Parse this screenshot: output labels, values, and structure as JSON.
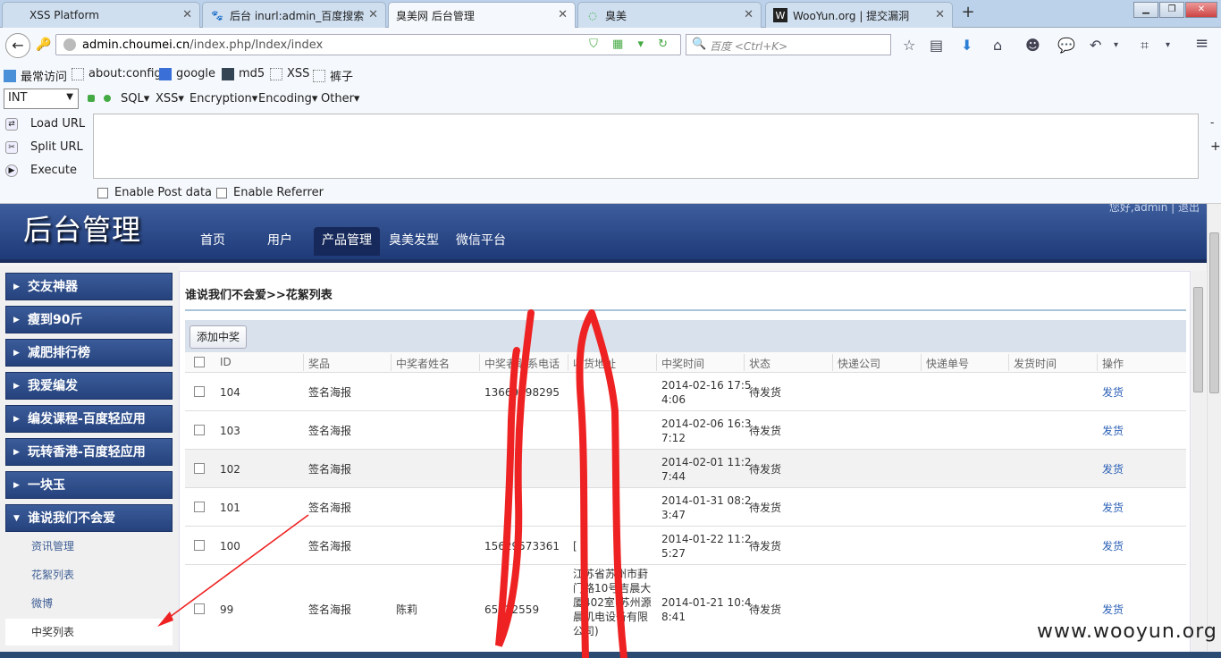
{
  "browser": {
    "tabs": [
      {
        "title": "XSS Platform"
      },
      {
        "title": "后台 inurl:admin_百度搜索"
      },
      {
        "title": "臭美网 后台管理"
      },
      {
        "title": "臭美"
      },
      {
        "title": "WooYun.org | 提交漏洞"
      }
    ],
    "active_tab": 2,
    "new_tab": "+",
    "url_host": "admin.choumei.cn",
    "url_path": "/index.php/Index/index",
    "search_placeholder": "百度 <Ctrl+K>"
  },
  "bookmarks": [
    "最常访问",
    "about:config",
    "google",
    "md5",
    "XSS",
    "裤子"
  ],
  "hackbar": {
    "select_value": "INT",
    "menus": [
      "SQL",
      "XSS",
      "Encryption",
      "Encoding",
      "Other"
    ],
    "load_url": "Load URL",
    "split_url": "Split URL",
    "execute": "Execute",
    "enable_post": "Enable Post data",
    "enable_referrer": "Enable Referrer",
    "side_minus": "-",
    "side_plus": "+"
  },
  "page": {
    "title": "后台管理",
    "user_line": "您好,admin | 退出",
    "nav": [
      "首页",
      "用户",
      "产品管理",
      "臭美发型",
      "微信平台"
    ],
    "active_nav": 2
  },
  "sidebar": {
    "groups": [
      "交友神器",
      "瘦到90斤",
      "减肥排行榜",
      "我爱编发",
      "编发课程-百度轻应用",
      "玩转香港-百度轻应用",
      "一块玉",
      "谁说我们不会爱"
    ],
    "sub_items": [
      "资讯管理",
      "花絮列表",
      "微博",
      "中奖列表"
    ],
    "active_sub": 3
  },
  "content": {
    "breadcrumb": "谁说我们不会爱>>花絮列表",
    "add_button": "添加中奖",
    "columns": [
      "ID",
      "奖品",
      "中奖者姓名",
      "中奖者联系电话",
      "收货地址",
      "中奖时间",
      "状态",
      "快递公司",
      "快递单号",
      "发货时间",
      "操作"
    ],
    "rows": [
      {
        "id": "104",
        "prize": "签名海报",
        "name": "",
        "phone": "13669798295",
        "address": "",
        "time1": "2014-02-16 17:5",
        "time2": "4:06",
        "status": "待发货",
        "action": "发货"
      },
      {
        "id": "103",
        "prize": "签名海报",
        "name": "",
        "phone": "",
        "address": "",
        "time1": "2014-02-06 16:3",
        "time2": "7:12",
        "status": "待发货",
        "action": "发货"
      },
      {
        "id": "102",
        "prize": "签名海报",
        "name": "",
        "phone": "",
        "address": "",
        "time1": "2014-02-01 11:2",
        "time2": "7:44",
        "status": "待发货",
        "action": "发货"
      },
      {
        "id": "101",
        "prize": "签名海报",
        "name": "",
        "phone": "",
        "address": "",
        "time1": "2014-01-31 08:2",
        "time2": "3:47",
        "status": "待发货",
        "action": "发货"
      },
      {
        "id": "100",
        "prize": "签名海报",
        "name": "",
        "phone": "15629573361",
        "address": "[",
        "time1": "2014-01-22 11:2",
        "time2": "5:27",
        "status": "待发货",
        "action": "发货"
      },
      {
        "id": "99",
        "prize": "签名海报",
        "name": "陈莉",
        "phone": "65222559",
        "address": "江苏省苏州市葑门路10号吉晨大厦402室(苏州源晨机电设备有限公司)",
        "time1": "2014-01-21 10:4",
        "time2": "8:41",
        "status": "待发货",
        "action": "发货"
      }
    ]
  },
  "watermark": "www.wooyun.org",
  "colors": {
    "header": "#2a4a8a",
    "sidebar": "#2f4f8e",
    "link": "#2a5fb5",
    "annotation": "#ee2222"
  }
}
